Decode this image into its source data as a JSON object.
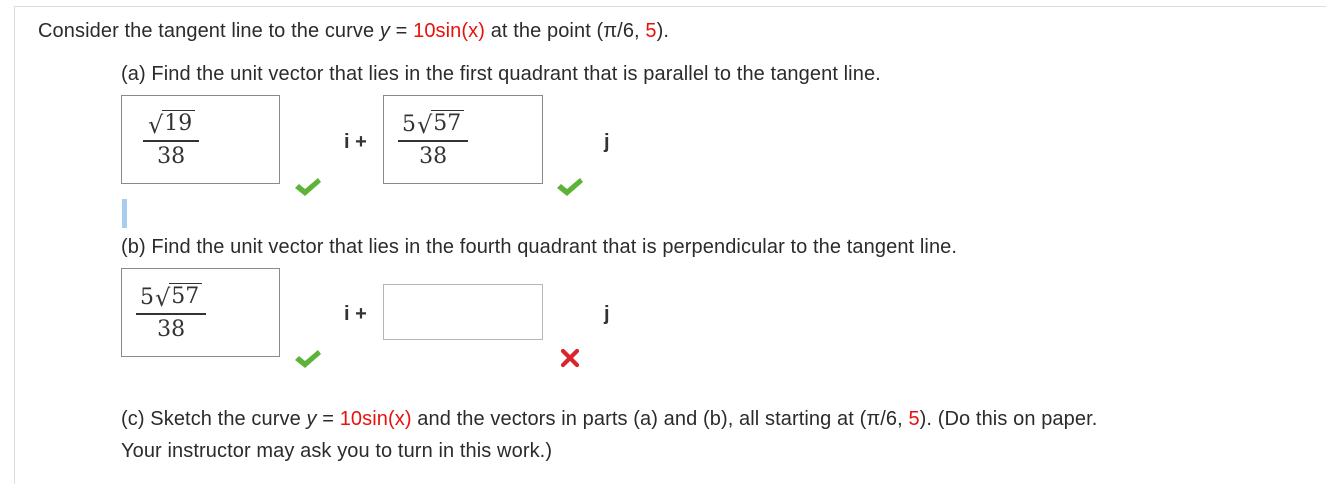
{
  "problem": {
    "intro_text": "Consider the tangent line to the curve ",
    "y_var": "y",
    "equals": " = ",
    "function": "10sin(x)",
    "at_text": " at the point (",
    "pi_over_6": "π/6, ",
    "point_y": "5",
    "close": ")."
  },
  "part_a": {
    "prompt": "(a) Find the unit vector that lies in the first quadrant that is parallel to the tangent line.",
    "i_answer": {
      "coef": "",
      "radicand": "19",
      "denominator": "38"
    },
    "i_label": "i +",
    "j_answer": {
      "coef": "5",
      "radicand": "57",
      "denominator": "38"
    },
    "j_label": "j",
    "i_status": "correct",
    "j_status": "correct"
  },
  "part_b": {
    "prompt": "(b) Find the unit vector that lies in the fourth quadrant that is perpendicular to the tangent line.",
    "i_answer": {
      "coef": "5",
      "radicand": "57",
      "denominator": "38"
    },
    "i_label": "i +",
    "j_answer_value": "",
    "j_label": "j",
    "i_status": "correct",
    "j_status": "incorrect"
  },
  "part_c": {
    "prompt_start": "(c) Sketch the curve ",
    "y_var": "y",
    "equals": " = ",
    "function": "10sin(x)",
    "mid_text": " and the vectors in parts (a) and (b), all starting at (",
    "pi_over_6": "π/6, ",
    "point_y": "5",
    "end_text": "). (Do this on paper.",
    "line2": "Your instructor may ask you to turn in this work.)"
  },
  "colors": {
    "highlight_red": "#e8120c",
    "check_green": "#5cb338",
    "cross_red": "#d9252c",
    "text": "#2b2b2b"
  },
  "icons": [
    "check-icon",
    "cross-icon",
    "radical-sign"
  ]
}
